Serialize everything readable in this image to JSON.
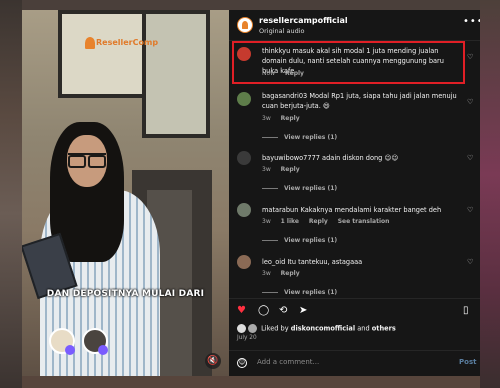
{
  "video": {
    "caption": "DAN DEPOSITNYA MULAI DARI",
    "logo_text": "ResellerComp"
  },
  "header": {
    "username": "resellercampofficial",
    "subtitle": "Original audio",
    "more_icon": "more-horizontal-icon"
  },
  "comments": [
    {
      "text": "thinkkyu masuk akal sih modal 1 juta mending jualan domain dulu, nanti setelah cuannya menggunung baru buka kafe",
      "time": "Now",
      "reply": "Reply",
      "view_replies": ""
    },
    {
      "text": "bagasandri03 Modal Rp1 juta, siapa tahu jadi jalan menuju cuan berjuta-juta. 😄",
      "time": "3w",
      "reply": "Reply",
      "view_replies": "View replies (1)"
    },
    {
      "text": "bayuwibowo7777 adain diskon dong 😉😉",
      "time": "3w",
      "reply": "Reply",
      "view_replies": "View replies (1)"
    },
    {
      "text": "matarabun Kakaknya mendalami karakter banget deh",
      "time": "3w",
      "likes": "1 like",
      "reply": "Reply",
      "translation": "See translation",
      "view_replies": "View replies (1)"
    },
    {
      "text": "leo_oid Itu tantekuu, astagaaa",
      "time": "3w",
      "reply": "Reply",
      "view_replies": "View replies (1)"
    }
  ],
  "liked_by": {
    "prefix": "Liked by",
    "user": "diskoncomofficial",
    "and": "and",
    "others": "others"
  },
  "date": "July 20",
  "add_comment": {
    "placeholder": "Add a comment...",
    "post_label": "Post"
  },
  "colors": {
    "panel_bg": "#161616",
    "highlight_border": "#e01f26",
    "like_red": "#ff3040"
  }
}
